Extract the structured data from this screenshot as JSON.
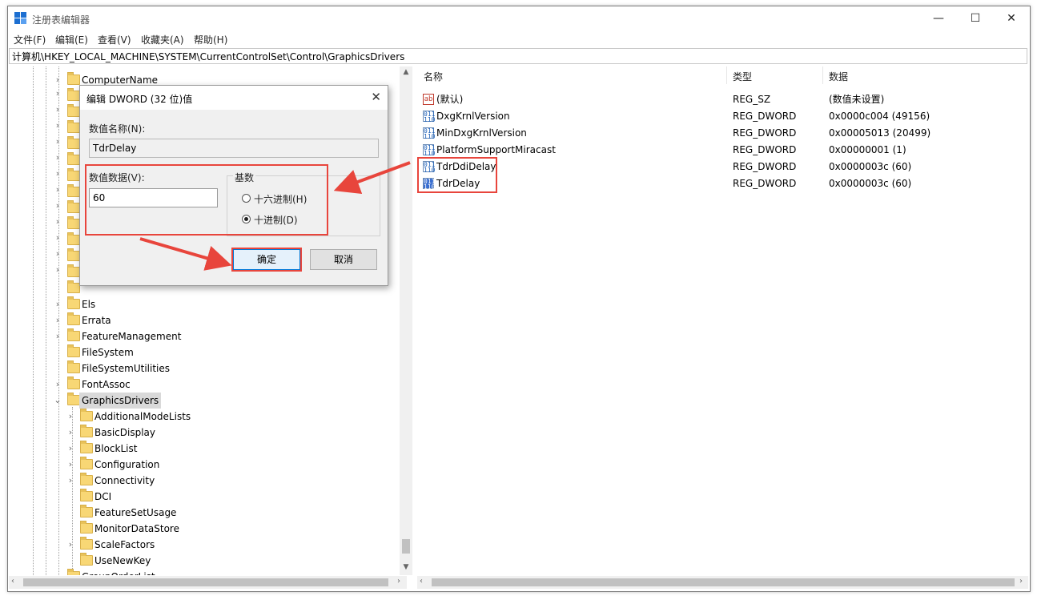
{
  "window": {
    "title": "注册表编辑器",
    "minimize": "—",
    "maximize": "☐",
    "close": "✕"
  },
  "menu": [
    "文件(F)",
    "编辑(E)",
    "查看(V)",
    "收藏夹(A)",
    "帮助(H)"
  ],
  "address": "计算机\\HKEY_LOCAL_MACHINE\\SYSTEM\\CurrentControlSet\\Control\\GraphicsDrivers",
  "tree": {
    "top_items": [
      "ComputerName"
    ],
    "mid_items": [
      "Els",
      "Errata",
      "FeatureManagement",
      "FileSystem",
      "FileSystemUtilities",
      "FontAssoc"
    ],
    "selected": "GraphicsDrivers",
    "children": [
      "AdditionalModeLists",
      "BasicDisplay",
      "BlockList",
      "Configuration",
      "Connectivity",
      "DCI",
      "FeatureSetUsage",
      "MonitorDataStore",
      "ScaleFactors",
      "UseNewKey"
    ],
    "bottom_item": "GroupOrderList"
  },
  "list": {
    "headers": {
      "name": "名称",
      "type": "类型",
      "data": "数据"
    },
    "rows": [
      {
        "icon": "string-value-icon",
        "name": "(默认)",
        "type": "REG_SZ",
        "data": "(数值未设置)"
      },
      {
        "icon": "binary-value-icon",
        "name": "DxgKrnlVersion",
        "type": "REG_DWORD",
        "data": "0x0000c004 (49156)"
      },
      {
        "icon": "binary-value-icon",
        "name": "MinDxgKrnlVersion",
        "type": "REG_DWORD",
        "data": "0x00005013 (20499)"
      },
      {
        "icon": "binary-value-icon",
        "name": "PlatformSupportMiracast",
        "type": "REG_DWORD",
        "data": "0x00000001 (1)"
      },
      {
        "icon": "binary-value-icon",
        "name": "TdrDdiDelay",
        "type": "REG_DWORD",
        "data": "0x0000003c (60)"
      },
      {
        "icon": "binary-value-icon",
        "name": "TdrDelay",
        "type": "REG_DWORD",
        "data": "0x0000003c (60)"
      }
    ]
  },
  "dialog": {
    "title": "编辑 DWORD (32 位)值",
    "close": "✕",
    "name_label": "数值名称(N):",
    "name_value": "TdrDelay",
    "data_label": "数值数据(V):",
    "data_value": "60",
    "base_label": "基数",
    "hex_label": "十六进制(H)",
    "dec_label": "十进制(D)",
    "selected_base": "dec",
    "ok": "确定",
    "cancel": "取消"
  },
  "colors": {
    "highlight": "#e8453c",
    "folder": "#f8d775",
    "accent": "#0078d7"
  },
  "icons": {
    "app": "registry-editor-icon",
    "expand": "chevron-right-icon",
    "collapse": "chevron-down-icon",
    "folder": "folder-icon"
  }
}
